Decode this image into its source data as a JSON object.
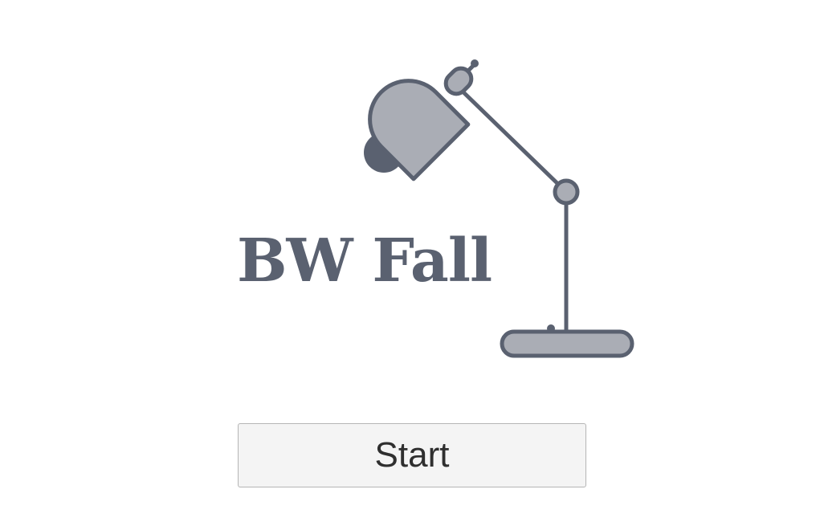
{
  "game": {
    "title": "BW Fall"
  },
  "start_button": {
    "label": "Start"
  },
  "colors": {
    "background": "#ffffff",
    "lamp_outline": "#5a6170",
    "lamp_fill": "#aaadb5",
    "title_text": "#5a6170",
    "button_background": "#f4f4f4",
    "button_border": "#b5b5b5",
    "button_text": "#2f2f2f"
  },
  "icons": {
    "logo": "desk-lamp-icon"
  }
}
